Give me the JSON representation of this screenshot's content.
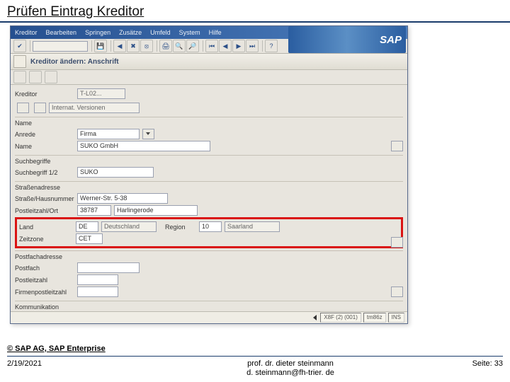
{
  "slide": {
    "title": "Prüfen Eintrag Kreditor"
  },
  "logo": "SAP",
  "menubar": [
    "Kreditor",
    "Bearbeiten",
    "Springen",
    "Zusätze",
    "Umfeld",
    "System",
    "Hilfe"
  ],
  "header": {
    "title": "Kreditor ändern: Anschrift"
  },
  "groups": {
    "name": "Name",
    "search": "Suchbegriffe",
    "street": "Straßenadresse",
    "pobox": "Postfachadresse",
    "communication": "Kommunikation"
  },
  "fields": {
    "kreditor": {
      "label": "Kreditor",
      "value": "T-L02..."
    },
    "version_button": "Internat. Versionen",
    "anrede": {
      "label": "Anrede",
      "value": "Firma"
    },
    "name": {
      "label": "Name",
      "value": "SUKO GmbH"
    },
    "suchbegriff": {
      "label": "Suchbegriff 1/2",
      "value": "SUKO"
    },
    "strasse": {
      "label": "Straße/Hausnummer",
      "value": "Werner-Str. 5-38"
    },
    "plz": {
      "label": "Postleitzahl/Ort",
      "value": "38787"
    },
    "ort": {
      "value": "Harlingerode"
    },
    "land": {
      "label": "Land",
      "value": "DE",
      "text": "Deutschland"
    },
    "region": {
      "label": "Region",
      "value": "10",
      "text": "Saarland"
    },
    "zeitzone": {
      "label": "Zeitzone",
      "value": "CET"
    },
    "postfach": {
      "label": "Postfach"
    },
    "postfachplz": {
      "label": "Postleitzahl"
    },
    "firmenpostlz": {
      "label": "Firmenpostleitzahl"
    }
  },
  "statusbar": {
    "system": "X8F (2) (001)",
    "client": "tm86z",
    "mode": "INS"
  },
  "footer": {
    "copyright": "© SAP AG, SAP Enterprise",
    "date": "2/19/2021",
    "author": "prof. dr. dieter steinmann",
    "email": "d. steinmann@fh-trier. de",
    "page": "Seite: 33"
  }
}
